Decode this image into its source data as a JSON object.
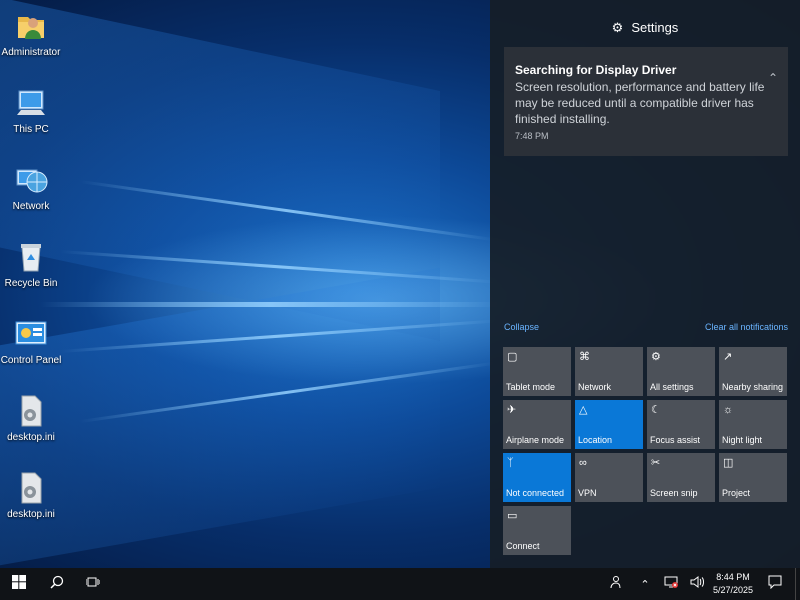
{
  "desktop": {
    "icons": [
      {
        "label": "Administrator",
        "icon": "user-folder-icon"
      },
      {
        "label": "This PC",
        "icon": "computer-icon"
      },
      {
        "label": "Network",
        "icon": "network-globe-icon"
      },
      {
        "label": "Recycle Bin",
        "icon": "recycle-bin-icon"
      },
      {
        "label": "Control Panel",
        "icon": "control-panel-icon"
      },
      {
        "label": "desktop.ini",
        "icon": "settings-file-icon"
      },
      {
        "label": "desktop.ini",
        "icon": "settings-file-icon"
      }
    ]
  },
  "action_center": {
    "header": {
      "title": "Settings",
      "icon": "gear-icon"
    },
    "notification": {
      "title": "Searching for Display Driver",
      "body": "Screen resolution, performance and battery life may be reduced until a compatible driver has finished installing.",
      "time": "7:48 PM",
      "collapse_icon": "chevron-up-icon"
    },
    "collapse_label": "Collapse",
    "clear_label": "Clear all notifications",
    "tiles": [
      {
        "label": "Tablet mode",
        "icon": "tablet-mode-icon",
        "active": false
      },
      {
        "label": "Network",
        "icon": "network-signal-icon",
        "active": false
      },
      {
        "label": "All settings",
        "icon": "gear-icon",
        "active": false
      },
      {
        "label": "Nearby sharing",
        "icon": "share-icon",
        "active": false
      },
      {
        "label": "Airplane mode",
        "icon": "airplane-icon",
        "active": false
      },
      {
        "label": "Location",
        "icon": "location-icon",
        "active": true
      },
      {
        "label": "Focus assist",
        "icon": "moon-icon",
        "active": false
      },
      {
        "label": "Night light",
        "icon": "sun-icon",
        "active": false
      },
      {
        "label": "Not connected",
        "icon": "bluetooth-icon",
        "active": true
      },
      {
        "label": "VPN",
        "icon": "vpn-icon",
        "active": false
      },
      {
        "label": "Screen snip",
        "icon": "screen-snip-icon",
        "active": false
      },
      {
        "label": "Project",
        "icon": "project-icon",
        "active": false
      },
      {
        "label": "Connect",
        "icon": "connect-icon",
        "active": false
      }
    ]
  },
  "taskbar": {
    "start_icon": "windows-logo-icon",
    "search_icon": "search-icon",
    "task_view_icon": "task-view-icon",
    "tray": {
      "people_icon": "people-icon",
      "overflow_icon": "chevron-up-icon",
      "network_icon": "network-disconnected-icon",
      "volume_icon": "speaker-icon",
      "time": "8:44 PM",
      "date": "5/27/2025",
      "notification_icon": "action-center-icon"
    }
  },
  "colors": {
    "accent": "#0a78d7",
    "tile_off": "#4c5159",
    "link": "#6ab4ff",
    "taskbar": "#101317"
  }
}
